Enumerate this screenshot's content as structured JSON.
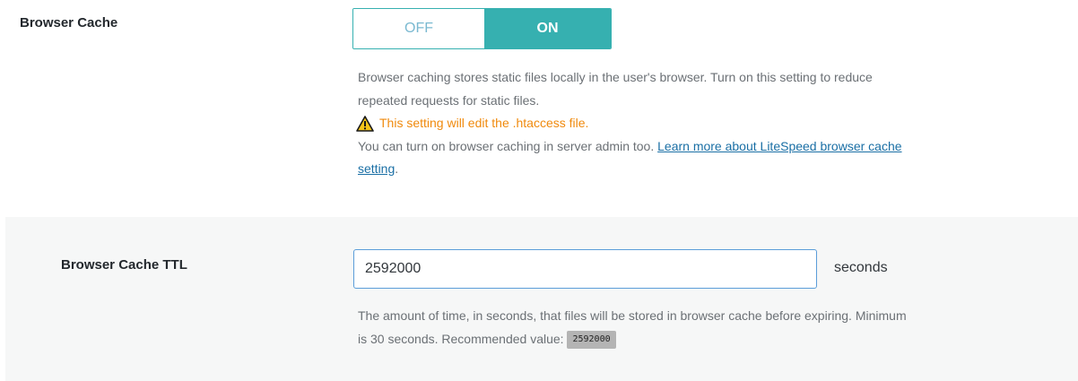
{
  "browser_cache": {
    "label": "Browser Cache",
    "toggle": {
      "off_label": "OFF",
      "on_label": "ON",
      "state": "ON"
    },
    "desc_line1": "Browser caching stores static files locally in the user's browser. Turn on this setting to reduce",
    "desc_line2": "repeated requests for static files.",
    "warning": "This setting will edit the .htaccess file.",
    "note_prefix": "You can turn on browser caching in server admin too.",
    "link_text": "Learn more about LiteSpeed browser cache setting",
    "link_part1": "Learn more about LiteSpeed browser cache",
    "link_part2": "setting",
    "note_suffix": ".",
    "warning_icon": "warning-triangle-icon",
    "accent_color": "#36b0b0",
    "warning_color": "#f08a0d"
  },
  "browser_cache_ttl": {
    "label": "Browser Cache TTL",
    "value": "2592000",
    "unit": "seconds",
    "desc_line1": "The amount of time, in seconds, that files will be stored in browser cache before expiring. Minimum",
    "desc_line2_prefix": "is 30 seconds. Recommended value:",
    "recommended": "2592000"
  }
}
